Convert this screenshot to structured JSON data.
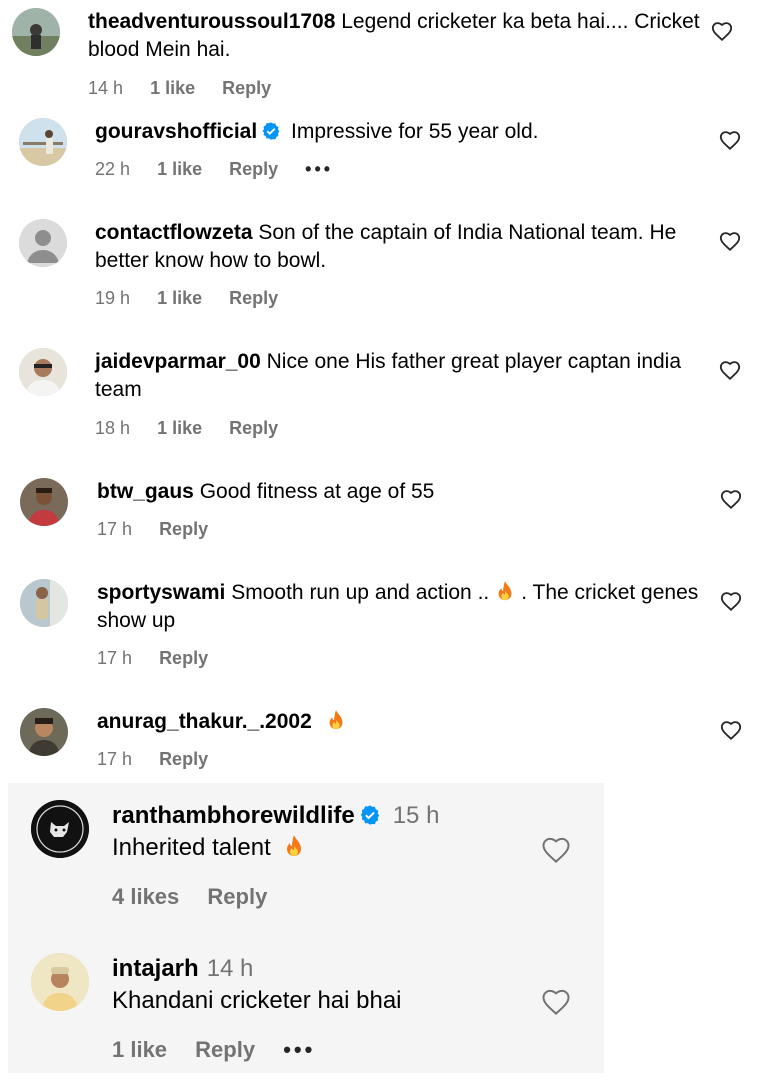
{
  "comments": [
    {
      "username": "theadventuroussoul1708",
      "text": "Legend cricketer ka beta hai.... Cricket",
      "text2": "blood Mein hai.",
      "time": "14 h",
      "likes": "1 like",
      "reply": "Reply"
    },
    {
      "username": "gouravshofficial",
      "text": "Impressive for 55 year old.",
      "time": "22 h",
      "likes": "1 like",
      "reply": "Reply",
      "more": "•••"
    },
    {
      "username": "contactflowzeta",
      "text": "Son of the captain of India National team. He",
      "text2": "better know how to bowl.",
      "time": "19 h",
      "likes": "1 like",
      "reply": "Reply"
    },
    {
      "username": "jaidevparmar_00",
      "text": "Nice one His father great player captan india",
      "text2": "team",
      "time": "18 h",
      "likes": "1 like",
      "reply": "Reply"
    },
    {
      "username": "btw_gaus",
      "text": "Good fitness at age of 55",
      "time": "17 h",
      "reply": "Reply"
    },
    {
      "username": "sportyswami",
      "text": "Smooth run up and action ..",
      "text_after": ". The cricket genes",
      "text2": "show up",
      "time": "17 h",
      "reply": "Reply"
    },
    {
      "username": "anurag_thakur._.2002",
      "time": "17 h",
      "reply": "Reply"
    }
  ],
  "replies": [
    {
      "username": "ranthambhorewildlife",
      "time": "15 h",
      "text": "Inherited talent",
      "likes": "4 likes",
      "reply": "Reply"
    },
    {
      "username": "intajarh",
      "time": "14 h",
      "text": "Khandani cricketer hai bhai",
      "likes": "1 like",
      "reply": "Reply",
      "more": "•••"
    }
  ],
  "icons": {
    "heart": "heart-outline-icon",
    "verified": "verified-badge-icon",
    "fire": "fire-emoji-icon",
    "more": "more-options-icon"
  },
  "colors": {
    "meta_gray": "#737373",
    "verified_blue": "#0095f6",
    "panel_bg": "#f5f5f5"
  }
}
